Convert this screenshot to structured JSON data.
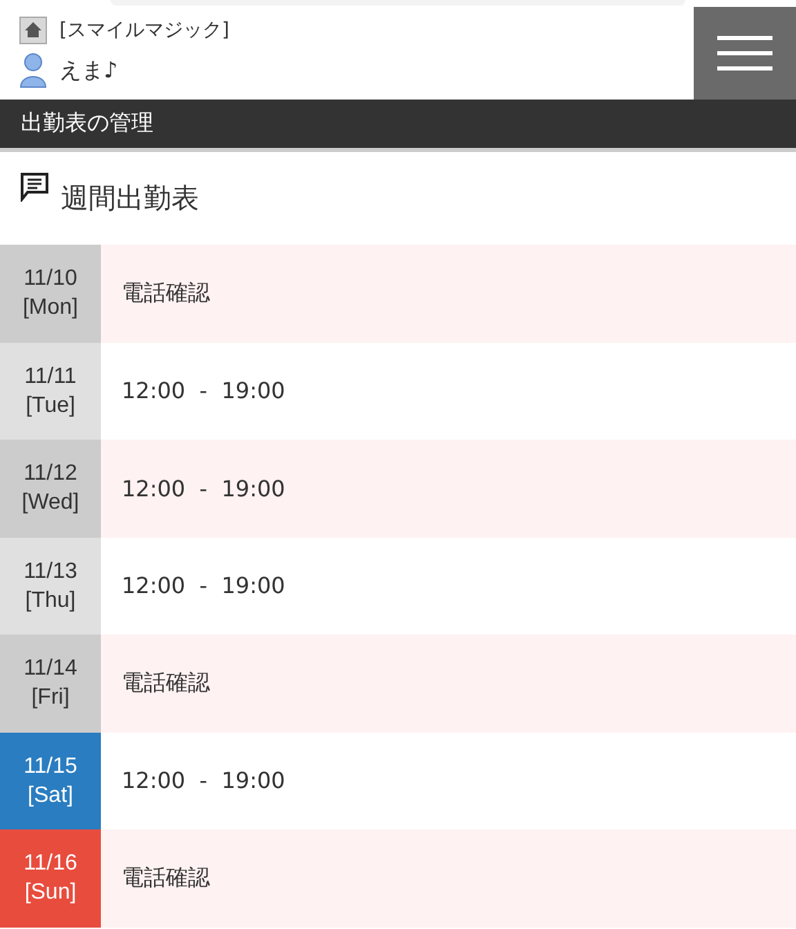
{
  "header": {
    "shop_name": "[スマイルマジック]",
    "user_name": "えま♪"
  },
  "page_title": "出勤表の管理",
  "section_title": "週間出勤表",
  "days": [
    {
      "date": "11/10",
      "weekday": "[Mon]",
      "shift": "電話確認",
      "color": "#cccccc"
    },
    {
      "date": "11/11",
      "weekday": "[Tue]",
      "shift": "12:00  -  19:00",
      "color": "#e0e0e0"
    },
    {
      "date": "11/12",
      "weekday": "[Wed]",
      "shift": "12:00  -  19:00",
      "color": "#cccccc"
    },
    {
      "date": "11/13",
      "weekday": "[Thu]",
      "shift": "12:00  -  19:00",
      "color": "#e0e0e0"
    },
    {
      "date": "11/14",
      "weekday": "[Fri]",
      "shift": "電話確認",
      "color": "#cccccc"
    },
    {
      "date": "11/15",
      "weekday": "[Sat]",
      "shift": "12:00  -  19:00",
      "color": "#2a7dc0"
    },
    {
      "date": "11/16",
      "weekday": "[Sun]",
      "shift": "電話確認",
      "color": "#e84c3d"
    }
  ]
}
